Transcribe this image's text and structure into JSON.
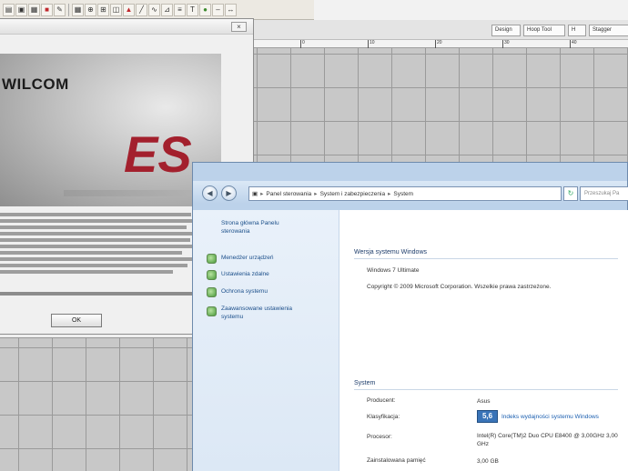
{
  "cad_app": {
    "toolbar_icons": [
      "folder-open-icon",
      "save-icon",
      "print-icon",
      "stop-icon",
      "pencil-icon",
      "grid-icon",
      "zoom-icon",
      "snap-icon",
      "palette-icon",
      "red-flag-icon",
      "line-icon",
      "wave-icon",
      "measure-icon",
      "bars-icon",
      "text-icon",
      "color-icon",
      "dash-icon",
      "arrow-icon"
    ],
    "tabs": [
      "Design",
      "Hoop Tool",
      "H",
      "Stagger"
    ],
    "ruler_labels": [
      "0",
      "10",
      "20",
      "30",
      "40"
    ]
  },
  "about_dialog": {
    "brand": "WILCOM",
    "logo": "ES",
    "ok_label": "OK"
  },
  "system_window": {
    "breadcrumb": [
      "Panel sterowania",
      "System i zabezpieczenia",
      "System"
    ],
    "search_placeholder": "Przeszukaj Pa",
    "tasks": {
      "home_line1": "Strona główna Panelu",
      "home_line2": "sterowania",
      "items": [
        "Menedżer urządzeń",
        "Ustawienia zdalne",
        "Ochrona systemu",
        "Zaawansowane ustawienia",
        "systemu"
      ]
    },
    "edition": {
      "title": "Wersja systemu Windows",
      "name": "Windows 7 Ultimate",
      "copyright": "Copyright © 2009 Microsoft Corporation. Wszelkie prawa zastrzeżone."
    },
    "system": {
      "title": "System",
      "rows": [
        {
          "label": "Producent:",
          "value": "Asus"
        },
        {
          "label": "Klasyfikacja:",
          "value": ""
        },
        {
          "label": "Procesor:",
          "value": "Intel(R) Core(TM)2 Duo CPU  E8400 @ 3,00GHz  3,00 GHz"
        },
        {
          "label": "Zainstalowana pamięć",
          "value": "3,00 GB"
        }
      ],
      "rating_value": "5,6",
      "rating_link": "Indeks wydajności systemu Windows"
    }
  }
}
